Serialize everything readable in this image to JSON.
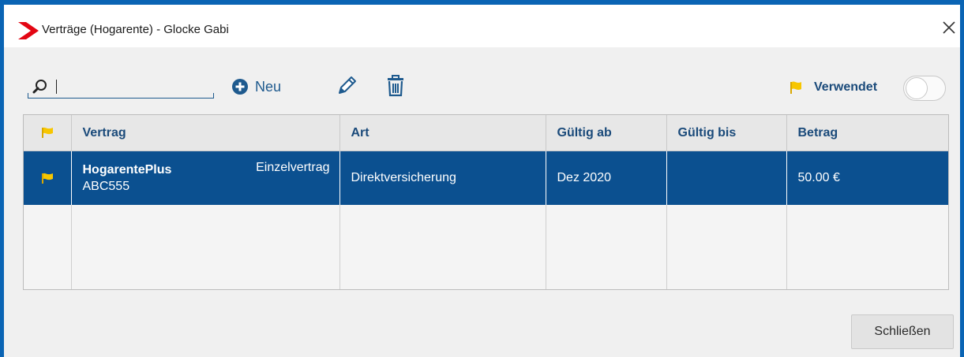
{
  "window": {
    "title": "Verträge (Hogarente) - Glocke Gabi",
    "brand_color": "#e30613",
    "accent_color": "#0a64b4"
  },
  "toolbar": {
    "search_value": "",
    "search_icon": "search-icon",
    "new_label": "Neu",
    "edit_icon": "pencil-icon",
    "delete_icon": "trash-icon",
    "filter_label": "Verwendet",
    "filter_toggle_on": false
  },
  "table": {
    "columns": [
      "",
      "Vertrag",
      "Art",
      "Gültig ab",
      "Gültig bis",
      "Betrag"
    ],
    "rows": [
      {
        "flag": "flag-icon",
        "vertrag_name": "HogarentePlus",
        "vertrag_number": "ABC555",
        "vertrag_type": "Einzelvertrag",
        "art": "Direktversicherung",
        "gueltig_ab": "Dez 2020",
        "gueltig_bis": "",
        "betrag": "50.00 €",
        "selected": true
      }
    ]
  },
  "footer": {
    "close_label": "Schließen"
  },
  "colors": {
    "selected_row": "#0b5090",
    "flag": "#f7c600",
    "header_text": "#1a4a7a"
  }
}
